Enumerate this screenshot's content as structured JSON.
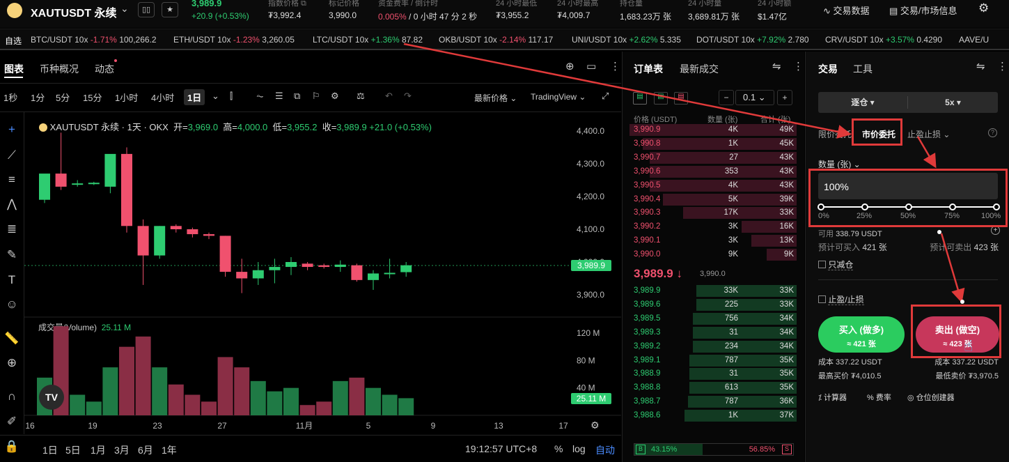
{
  "header": {
    "symbol": "XAUTUSDT 永续",
    "price": "3,989.9",
    "change": "+20.9 (+0.53%)",
    "stats": [
      {
        "label": "指数价格 ⧉",
        "value": "₮3,992.4"
      },
      {
        "label": "标记价格",
        "value": "3,990.0"
      },
      {
        "label": "资金费率 / 倒计时",
        "value_rate": "0.005%",
        "value_rest": " / 0 小时 47 分 2 秒"
      },
      {
        "label": "24 小时最低",
        "value": "₮3,955.2"
      },
      {
        "label": "24 小时最高",
        "value": "₮4,009.7"
      },
      {
        "label": "持仓量",
        "value": "1,683.23万 张"
      },
      {
        "label": "24 小时量",
        "value": "3,689.81万 张"
      },
      {
        "label": "24 小时额",
        "value": "$1.47亿"
      }
    ],
    "btn_trade_data": "交易数据",
    "btn_market_info": "交易/市场信息"
  },
  "ticker": {
    "label": "自选",
    "items": [
      {
        "pair": "BTC/USDT 10x",
        "chg": "-1.71%",
        "price": "100,266.2",
        "up": false
      },
      {
        "pair": "ETH/USDT 10x",
        "chg": "-1.23%",
        "price": "3,260.05",
        "up": false
      },
      {
        "pair": "LTC/USDT 10x",
        "chg": "+1.36%",
        "price": "87.82",
        "up": true
      },
      {
        "pair": "OKB/USDT 10x",
        "chg": "-2.14%",
        "price": "117.17",
        "up": false
      },
      {
        "pair": "UNI/USDT 10x",
        "chg": "+2.62%",
        "price": "5.335",
        "up": true
      },
      {
        "pair": "DOT/USDT 10x",
        "chg": "+7.92%",
        "price": "2.780",
        "up": true
      },
      {
        "pair": "CRV/USDT 10x",
        "chg": "+3.57%",
        "price": "0.4290",
        "up": true
      },
      {
        "pair": "AAVE/U",
        "chg": "",
        "price": "",
        "up": true
      }
    ]
  },
  "chart": {
    "tabs": [
      "图表",
      "币种概况",
      "动态"
    ],
    "timeframes": [
      "1秒",
      "1分",
      "5分",
      "15分",
      "1小时",
      "4小时",
      "1日"
    ],
    "price_type": "最新价格",
    "view": "TradingView",
    "legend": {
      "title": "XAUTUSDT 永续 · 1天 · OKX",
      "open_l": "开=",
      "open": "3,969.0",
      "high_l": "高=",
      "high": "4,000.0",
      "low_l": "低=",
      "low": "3,955.2",
      "close_l": "收=",
      "close": "3,989.9",
      "chg": "+21.0 (+0.53%)"
    },
    "volume_label": "成交量(Volume)",
    "volume_value": "25.11 M",
    "last_price_tag": "3,989.9",
    "last_vol_tag": "25.11 M",
    "bottom_ranges": [
      "1日",
      "5日",
      "1月",
      "3月",
      "6月",
      "1年"
    ],
    "clock": "19:12:57 UTC+8",
    "pct": "%",
    "log": "log",
    "auto": "自动"
  },
  "chart_data": {
    "type": "candlestick",
    "price_ticks": [
      "4,400.0",
      "4,300.0",
      "4,200.0",
      "4,100.0",
      "4,000.0",
      "3,900.0"
    ],
    "price_tick_values": [
      4400,
      4300,
      4200,
      4100,
      4000,
      3900
    ],
    "vol_ticks": [
      "120 M",
      "80 M",
      "40 M"
    ],
    "vol_tick_values": [
      120,
      80,
      40
    ],
    "x_ticks": [
      "16",
      "19",
      "23",
      "27",
      "11月",
      "5",
      "9",
      "13",
      "17"
    ],
    "candles": [
      {
        "o": 4190,
        "h": 4215,
        "l": 4180,
        "c": 4270,
        "v": 55,
        "up": true
      },
      {
        "o": 4270,
        "h": 4395,
        "l": 4220,
        "c": 4230,
        "v": 130,
        "up": false
      },
      {
        "o": 4240,
        "h": 4250,
        "l": 4230,
        "c": 4240,
        "v": 30,
        "up": true
      },
      {
        "o": 4240,
        "h": 4245,
        "l": 4235,
        "c": 4242,
        "v": 20,
        "up": true
      },
      {
        "o": 4230,
        "h": 4310,
        "l": 4210,
        "c": 4330,
        "v": 70,
        "up": true
      },
      {
        "o": 4330,
        "h": 4350,
        "l": 4090,
        "c": 4110,
        "v": 100,
        "up": false
      },
      {
        "o": 4110,
        "h": 4130,
        "l": 3930,
        "c": 4020,
        "v": 115,
        "up": false
      },
      {
        "o": 4020,
        "h": 4110,
        "l": 4010,
        "c": 4110,
        "v": 70,
        "up": true
      },
      {
        "o": 4110,
        "h": 4115,
        "l": 4090,
        "c": 4100,
        "v": 45,
        "up": false
      },
      {
        "o": 4100,
        "h": 4105,
        "l": 4075,
        "c": 4085,
        "v": 30,
        "up": false
      },
      {
        "o": 4085,
        "h": 4090,
        "l": 4070,
        "c": 4080,
        "v": 20,
        "up": false
      },
      {
        "o": 4080,
        "h": 4080,
        "l": 3955,
        "c": 3970,
        "v": 85,
        "up": false
      },
      {
        "o": 3970,
        "h": 4010,
        "l": 3905,
        "c": 3950,
        "v": 70,
        "up": false
      },
      {
        "o": 3950,
        "h": 4000,
        "l": 3930,
        "c": 3975,
        "v": 50,
        "up": true
      },
      {
        "o": 3975,
        "h": 4010,
        "l": 3935,
        "c": 3985,
        "v": 35,
        "up": true
      },
      {
        "o": 3985,
        "h": 4015,
        "l": 3960,
        "c": 4000,
        "v": 40,
        "up": true
      },
      {
        "o": 3995,
        "h": 4000,
        "l": 3975,
        "c": 3985,
        "v": 15,
        "up": false
      },
      {
        "o": 3990,
        "h": 3995,
        "l": 3980,
        "c": 3985,
        "v": 20,
        "up": false
      },
      {
        "o": 3985,
        "h": 4005,
        "l": 3970,
        "c": 3992,
        "v": 50,
        "up": true
      },
      {
        "o": 3990,
        "h": 3995,
        "l": 3940,
        "c": 3945,
        "v": 55,
        "up": false
      },
      {
        "o": 3945,
        "h": 3975,
        "l": 3915,
        "c": 3965,
        "v": 40,
        "up": true
      },
      {
        "o": 3965,
        "h": 4010,
        "l": 3950,
        "c": 3967,
        "v": 30,
        "up": true
      },
      {
        "o": 3969,
        "h": 4000,
        "l": 3955,
        "c": 3990,
        "v": 25,
        "up": true
      }
    ]
  },
  "orderbook": {
    "tabs": [
      "订单表",
      "最新成交"
    ],
    "step": "0.1",
    "headers": [
      "价格 (USDT)",
      "数量 (张)",
      "合计 (张)"
    ],
    "asks": [
      {
        "p": "3,990.9",
        "q": "4K",
        "t": "49K",
        "d": 1.0
      },
      {
        "p": "3,990.8",
        "q": "1K",
        "t": "45K",
        "d": 0.92
      },
      {
        "p": "3,990.7",
        "q": "27",
        "t": "43K",
        "d": 0.88
      },
      {
        "p": "3,990.6",
        "q": "353",
        "t": "43K",
        "d": 0.88
      },
      {
        "p": "3,990.5",
        "q": "4K",
        "t": "43K",
        "d": 0.88
      },
      {
        "p": "3,990.4",
        "q": "5K",
        "t": "39K",
        "d": 0.8
      },
      {
        "p": "3,990.3",
        "q": "17K",
        "t": "33K",
        "d": 0.68
      },
      {
        "p": "3,990.2",
        "q": "3K",
        "t": "16K",
        "d": 0.33
      },
      {
        "p": "3,990.1",
        "q": "3K",
        "t": "13K",
        "d": 0.27
      },
      {
        "p": "3,990.0",
        "q": "9K",
        "t": "9K",
        "d": 0.18
      }
    ],
    "mid": {
      "price": "3,989.9 ↓",
      "mark": "3,990.0"
    },
    "bids": [
      {
        "p": "3,989.9",
        "q": "33K",
        "t": "33K",
        "d": 0.6
      },
      {
        "p": "3,989.6",
        "q": "225",
        "t": "33K",
        "d": 0.6
      },
      {
        "p": "3,989.5",
        "q": "756",
        "t": "34K",
        "d": 0.62
      },
      {
        "p": "3,989.3",
        "q": "31",
        "t": "34K",
        "d": 0.62
      },
      {
        "p": "3,989.2",
        "q": "234",
        "t": "34K",
        "d": 0.62
      },
      {
        "p": "3,989.1",
        "q": "787",
        "t": "35K",
        "d": 0.64
      },
      {
        "p": "3,988.9",
        "q": "31",
        "t": "35K",
        "d": 0.64
      },
      {
        "p": "3,988.8",
        "q": "613",
        "t": "35K",
        "d": 0.64
      },
      {
        "p": "3,988.7",
        "q": "787",
        "t": "36K",
        "d": 0.65
      },
      {
        "p": "3,988.6",
        "q": "1K",
        "t": "37K",
        "d": 0.67
      }
    ],
    "buy_ratio": "43.15%",
    "sell_ratio": "56.85%",
    "buy_frac": 0.4315,
    "b": "B",
    "s": "S"
  },
  "trade": {
    "tabs": [
      "交易",
      "工具"
    ],
    "margin_mode": "逐仓",
    "leverage": "5x",
    "order_types": [
      "限价委托",
      "市价委托",
      "止盈止损"
    ],
    "qty_label": "数量 (张)",
    "qty_value": "100%",
    "slider_pct": 1.0,
    "slider_labels": [
      "0%",
      "25%",
      "50%",
      "75%",
      "100%"
    ],
    "avail_label": "可用",
    "avail": "338.79 USDT",
    "can_buy_label": "预计可买入",
    "can_buy": "421 张",
    "can_sell_label": "预计可卖出",
    "can_sell": "423 张",
    "reduce_only": "只减仓",
    "tp_sl": "止盈/止损",
    "buy_btn": "买入 (做多)",
    "buy_sub": "≈ 421 张",
    "sell_btn": "卖出 (做空)",
    "sell_sub": "≈ 423 张",
    "cost_buy": "成本 337.22 USDT",
    "cost_sell": "成本 337.22 USDT",
    "max_buy": "最高买价 ₮4,010.5",
    "min_sell": "最低卖价 ₮3,970.5",
    "tools": [
      "计算器",
      "费率",
      "仓位创建器"
    ]
  }
}
